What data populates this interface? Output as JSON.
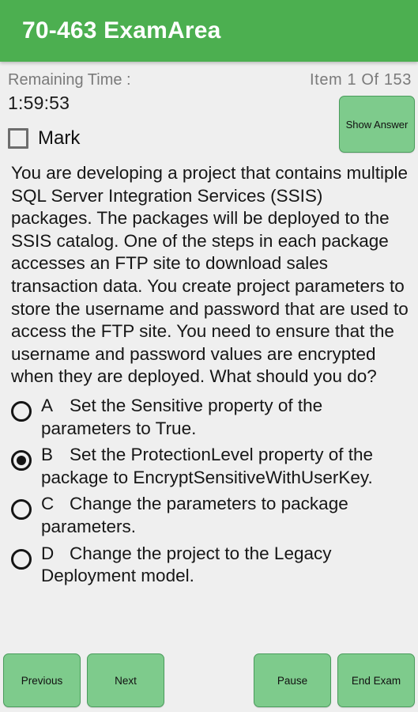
{
  "app": {
    "title": "70-463 ExamArea",
    "header_color": "#4caf50",
    "background_color": "#efefef",
    "button_color": "#7ecb8c",
    "button_border_color": "#4a9c5c"
  },
  "status": {
    "remaining_time_label": "Remaining Time :",
    "item_counter": "Item 1 Of 153",
    "timer_value": "1:59:53"
  },
  "mark": {
    "label": "Mark",
    "checked": false
  },
  "show_answer": {
    "label": "Show Answer"
  },
  "question": {
    "text": "You are developing a project that contains multiple SQL Server Integration Services (SSIS) packages. The packages will be deployed to the SSIS catalog. One of the steps in each package accesses an FTP site to download sales transaction data. You create project parameters to store the username and password that are used to access the FTP site. You need to ensure that the username and password values are encrypted when they are deployed. What should you do?"
  },
  "options": [
    {
      "letter": "A",
      "text": "Set the Sensitive property of the parameters to True.",
      "selected": false
    },
    {
      "letter": "B",
      "text": "Set the ProtectionLevel property of the package to EncryptSensitiveWithUserKey.",
      "selected": true
    },
    {
      "letter": "C",
      "text": "Change the parameters to package parameters.",
      "selected": false
    },
    {
      "letter": "D",
      "text": "Change the project to the Legacy Deployment model.",
      "selected": false
    }
  ],
  "bottom_bar": {
    "previous_label": "Previous",
    "next_label": "Next",
    "pause_label": "Pause",
    "end_exam_label": "End Exam"
  }
}
